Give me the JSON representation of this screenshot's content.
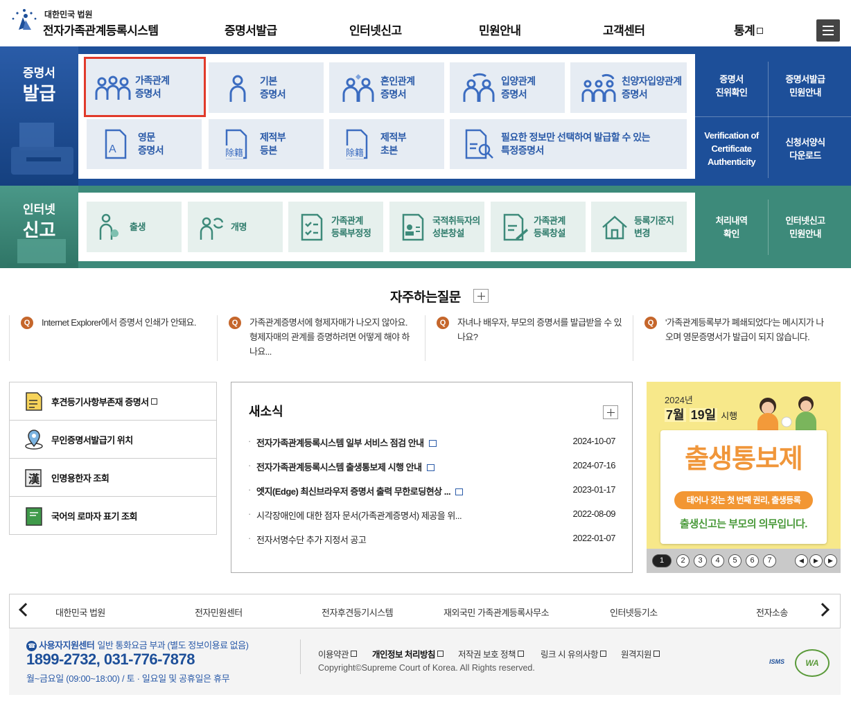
{
  "header": {
    "logo_sub": "대한민국 법원",
    "logo_main": "전자가족관계등록시스템",
    "nav": [
      "증명서발급",
      "인터넷신고",
      "민원안내",
      "고객센터",
      "통계"
    ]
  },
  "cert_section": {
    "label_line1": "증명서",
    "label_line2": "발급",
    "cards": [
      {
        "line1": "가족관계",
        "line2": "증명서"
      },
      {
        "line1": "기본",
        "line2": "증명서"
      },
      {
        "line1": "혼인관계",
        "line2": "증명서"
      },
      {
        "line1": "입양관계",
        "line2": "증명서"
      },
      {
        "line1": "친양자입양관계",
        "line2": "증명서"
      },
      {
        "line1": "영문",
        "line2": "증명서"
      },
      {
        "line1": "제적부",
        "line2": "등본"
      },
      {
        "line1": "제적부",
        "line2": "초본"
      },
      {
        "line1": "필요한 정보만 선택하여 발급할 수 있는",
        "line2": "특정증명서"
      }
    ],
    "side_links": [
      {
        "line1": "증명서",
        "line2": "진위확인"
      },
      {
        "line1": "증명서발급",
        "line2": "민원안내"
      },
      {
        "line1": "Verification of",
        "line2": "Certificate",
        "line3": "Authenticity"
      },
      {
        "line1": "신청서양식",
        "line2": "다운로드"
      }
    ],
    "icon_hanja": "除籍"
  },
  "report_section": {
    "label_line1": "인터넷",
    "label_line2": "신고",
    "cards": [
      {
        "line1": "출생",
        "line2": ""
      },
      {
        "line1": "개명",
        "line2": ""
      },
      {
        "line1": "가족관계",
        "line2": "등록부정정"
      },
      {
        "line1": "국적취득자의",
        "line2": "성본창설"
      },
      {
        "line1": "가족관계",
        "line2": "등록창설"
      },
      {
        "line1": "등록기준지",
        "line2": "변경"
      }
    ],
    "side_links": [
      {
        "line1": "처리내역",
        "line2": "확인"
      },
      {
        "line1": "인터넷신고",
        "line2": "민원안내"
      }
    ]
  },
  "faq": {
    "title": "자주하는질문",
    "q_badge": "Q",
    "items": [
      "Internet Explorer에서 증명서 인쇄가 안돼요.",
      "가족관계증명서에 형제자매가 나오지 않아요. 형제자매의 관계를 증명하려면 어떻게 해야 하나요...",
      "자녀나 배우자, 부모의 증명서를 발급받을 수 있나요?",
      "'가족관계등록부가 폐쇄되었다'는 메시지가 나오며 영문증명서가 발급이 되지 않습니다."
    ]
  },
  "quick_links": [
    "후견등기사항부존재 증명서",
    "무인증명서발급기 위치",
    "인명용한자 조회",
    "국어의 로마자 표기 조회"
  ],
  "quick_icon_hanja": "漢",
  "news": {
    "title": "새소식",
    "items": [
      {
        "title": "전자가족관계등록시스템 일부 서비스 점검 안내",
        "date": "2024-10-07"
      },
      {
        "title": "전자가족관계등록시스템 출생통보제 시행 안내",
        "date": "2024-07-16"
      },
      {
        "title": "엣지(Edge) 최신브라우저 증명서 출력 무한로딩현상 ...",
        "date": "2023-01-17"
      },
      {
        "title": "시각장애인에 대한 점자 문서(가족관계증명서) 제공을 위...",
        "date": "2022-08-09"
      },
      {
        "title": "전자서명수단 추가 지정서 공고",
        "date": "2022-01-07"
      }
    ]
  },
  "banner": {
    "year": "2024년",
    "month": "7월",
    "day": "19일",
    "effective": "시행",
    "headline": "출생통보제",
    "ribbon": "태어나 갖는 첫 번째 권리, 출생등록",
    "duty": "출생신고는 부모의 의무입니다.",
    "pages": [
      "1",
      "2",
      "3",
      "4",
      "5",
      "6",
      "7"
    ],
    "current_page": 1
  },
  "family_sites": [
    "대한민국 법원",
    "전자민원센터",
    "전자후견등기시스템",
    "재외국민 가족관계등록사무소",
    "인터넷등기소",
    "전자소송"
  ],
  "footer": {
    "center_label": "사용자지원센터",
    "center_note": "일반 통화요금 부과 (별도 정보이용료 없음)",
    "phone": "1899-2732, 031-776-7878",
    "hours": "월~금요일 (09:00~18:00) / 토 · 일요일 및 공휴일은 휴무",
    "links": [
      "이용약관",
      "개인정보 처리방침",
      "저작권 보호 정책",
      "링크 시 유의사항",
      "원격지원"
    ],
    "copyright": "Copyright©Supreme Court of Korea. All Rights reserved.",
    "badge_isms": "ISMS",
    "badge_wa": "WA"
  },
  "colors": {
    "blue": "#1d4f99",
    "green": "#3d8a7a",
    "orange": "#c5662b",
    "select": "#e13a2a"
  }
}
